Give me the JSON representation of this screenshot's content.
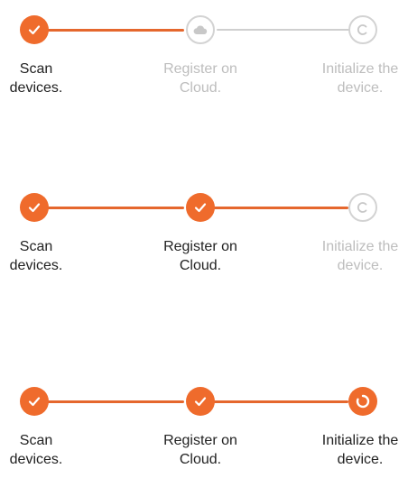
{
  "steps": {
    "scan": "Scan\ndevices.",
    "register": "Register on\nCloud.",
    "initialize": "Initialize the\ndevice."
  },
  "colors": {
    "accent": "#ef6b2c",
    "inactive": "#cfcfcf",
    "muted_text": "#bdbdbd"
  },
  "steppers": [
    {
      "scan": "completed",
      "register": "in-progress",
      "initialize": "pending"
    },
    {
      "scan": "completed",
      "register": "completed",
      "initialize": "pending"
    },
    {
      "scan": "completed",
      "register": "completed",
      "initialize": "in-progress"
    }
  ]
}
